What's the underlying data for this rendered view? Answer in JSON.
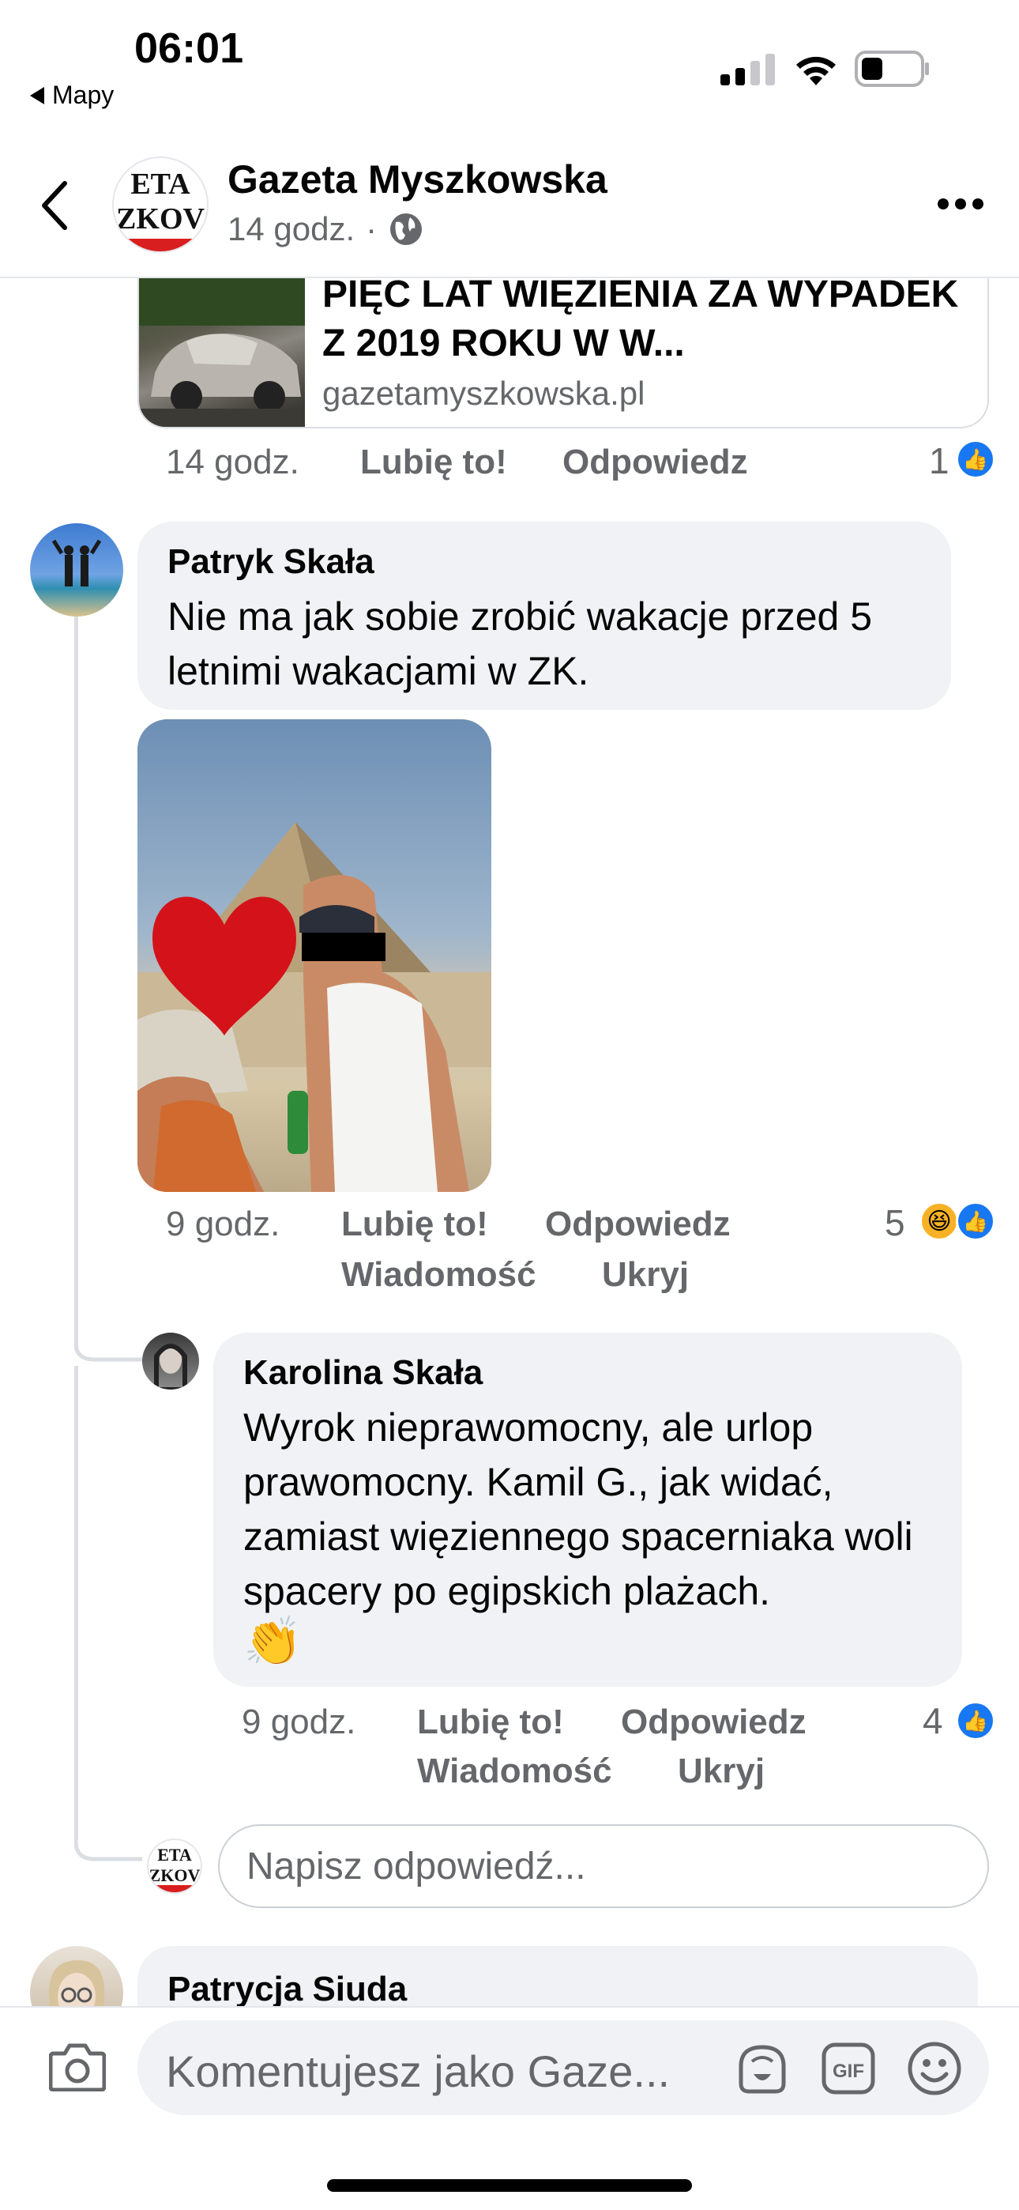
{
  "status_bar": {
    "time": "06:01",
    "back_app": "Mapy"
  },
  "header": {
    "page_name": "Gazeta Myszkowska",
    "avatar_text_line1": "ETA",
    "avatar_text_line2": "ZKOV",
    "time": "14 godz.",
    "separator": "·"
  },
  "link_preview": {
    "title": "PIĘC LAT WIĘZIENIA ZA WYPADEK Z 2019 ROKU W W...",
    "domain": "gazetamyszkowska.pl",
    "time": "14 godz.",
    "like_label": "Lubię to!",
    "reply_label": "Odpowiedz",
    "reaction_count": "1"
  },
  "comments": [
    {
      "author": "Patryk Skała",
      "text": "Nie ma jak sobie zrobić wakacje przed 5 letnimi wakacjami w ZK.",
      "time": "9 godz.",
      "like_label": "Lubię to!",
      "reply_label": "Odpowiedz",
      "message_label": "Wiadomość",
      "hide_label": "Ukryj",
      "reaction_count": "5"
    },
    {
      "author": "Karolina Skała",
      "text": "Wyrok nieprawomocny, ale urlop prawomocny. Kamil G., jak widać, zamiast więziennego spacerniaka woli spacery po egipskich plażach.",
      "emoji": "👏",
      "time": "9 godz.",
      "like_label": "Lubię to!",
      "reply_label": "Odpowiedz",
      "message_label": "Wiadomość",
      "hide_label": "Ukryj",
      "reaction_count": "4"
    },
    {
      "author": "Patrycja Siuda"
    }
  ],
  "reply_box": {
    "placeholder": "Napisz odpowiedź..."
  },
  "composer": {
    "placeholder": "Komentujesz jako Gaze..."
  },
  "colors": {
    "accent": "#1877f2",
    "bubble": "#f0f2f5",
    "secondary_text": "#65676b"
  },
  "icons": [
    "back-chevron-icon",
    "globe-icon",
    "more-icon",
    "like-icon",
    "haha-icon",
    "camera-icon",
    "avatar-sticker-icon",
    "gif-icon",
    "emoji-icon",
    "signal-icon",
    "wifi-icon",
    "battery-icon"
  ]
}
